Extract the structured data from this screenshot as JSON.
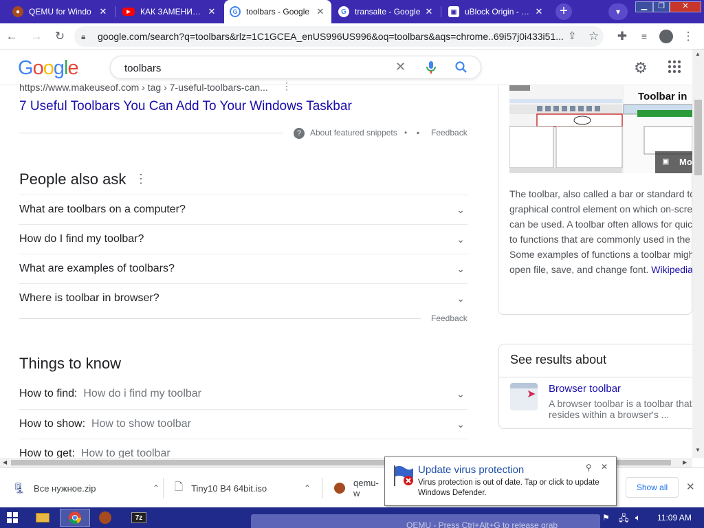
{
  "tabs": [
    {
      "title": "QEMU for Windo",
      "active": false
    },
    {
      "title": "КАК ЗАМЕНИТЬ I",
      "active": false
    },
    {
      "title": "toolbars - Google",
      "active": true
    },
    {
      "title": "transalte - Google",
      "active": false
    },
    {
      "title": "uBlock Origin - Ch",
      "active": false
    }
  ],
  "address": {
    "url": "google.com/search?q=toolbars&rlz=1C1GCEA_enUS996US996&oq=toolbars&aqs=chrome..69i57j0i433i51..."
  },
  "google": {
    "logo": "Google",
    "query": "toolbars"
  },
  "featured": {
    "cite": "https://www.makeuseof.com › tag › 7-useful-toolbars-can...",
    "title": "7 Useful Toolbars You Can Add To Your Windows Taskbar",
    "about": "About featured snippets",
    "dot": "•",
    "feedback": "Feedback"
  },
  "paa": {
    "heading": "People also ask",
    "questions": [
      "What are toolbars on a computer?",
      "How do I find my toolbar?",
      "What are examples of toolbars?",
      "Where is toolbar in browser?"
    ],
    "feedback": "Feedback"
  },
  "things": {
    "heading": "Things to know",
    "items": [
      {
        "label": "How to find:",
        "value": "How do i find my toolbar"
      },
      {
        "label": "How to show:",
        "value": "How to show toolbar"
      },
      {
        "label": "How to get:",
        "value": "How to get toolbar"
      }
    ]
  },
  "knowledge": {
    "image_text": "Toolbar in",
    "more": "Mo",
    "lines": [
      "The toolbar, also called a bar or standard to",
      "graphical control element on which on-scre",
      "can be used. A toolbar often allows for quic",
      "to functions that are commonly used in the",
      "Some examples of functions a toolbar migh",
      "open file, save, and change font."
    ],
    "source": "Wikipedia"
  },
  "see_results": {
    "heading": "See results about",
    "title": "Browser toolbar",
    "desc1": "A browser toolbar is a toolbar that",
    "desc2": "resides within a browser's ..."
  },
  "downloads": {
    "items": [
      "Все нужное.zip",
      "Tiny10 B4 64bit.iso",
      "qemu-w"
    ],
    "show_all": "Show all"
  },
  "notification": {
    "title": "Update virus protection",
    "body1": "Virus protection is out of date. Tap or click to update",
    "body2": "Windows Defender."
  },
  "taskbar": {
    "clock": "11:09 AM",
    "qemu_hint": "QEMU - Press Ctrl+Alt+G to release grab"
  },
  "colors": {
    "tabstrip": "#3c2ab1",
    "link": "#1a0dab",
    "taskbar": "#1f2a8a"
  }
}
